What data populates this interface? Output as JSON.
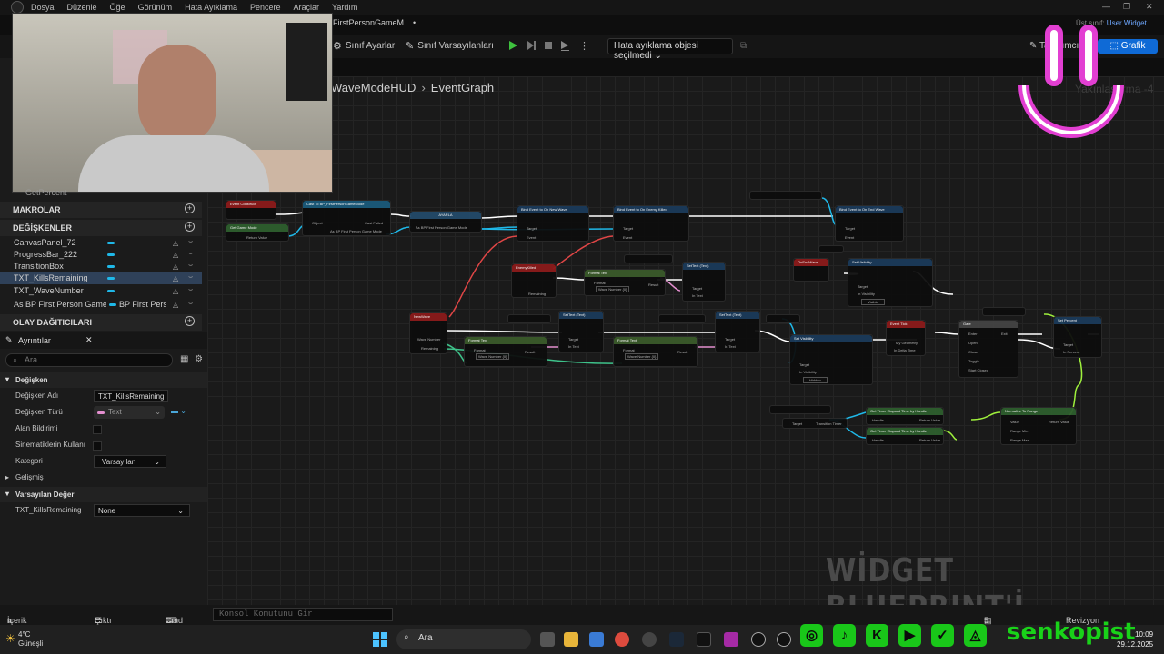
{
  "menu": [
    "Dosya",
    "Düzenle",
    "Öğe",
    "Görünüm",
    "Hata Ayıklama",
    "Pencere",
    "Araçlar",
    "Yardım"
  ],
  "document_tab": "FirstPersonGameM... •",
  "parent_class": {
    "label": "Üst sınıf:",
    "value": "User Widget"
  },
  "toolbar": {
    "class_settings": "Sınıf Ayarları",
    "class_defaults": "Sınıf Varsayılanları",
    "debug_select": "Hata ayıklama objesi seçilmedi",
    "graph_button": "Grafik",
    "designer_label": "Tasarımcı"
  },
  "breadcrumb": {
    "parent": "WaveModeHUD",
    "current": "EventGraph"
  },
  "zoom_label": "Yakınlaştırma -4",
  "watermark": "WİDGET BLUEPRINT'İ",
  "left_panel": {
    "partial_item": "GetPercent",
    "macros_label": "MAKROLAR",
    "variables_label": "DEĞİŞKENLER",
    "variables": [
      {
        "name": "CanvasPanel_72",
        "selected": false
      },
      {
        "name": "ProgressBar_222",
        "selected": false
      },
      {
        "name": "TransitionBox",
        "selected": false
      },
      {
        "name": "TXT_KillsRemaining",
        "selected": true
      },
      {
        "name": "TXT_WaveNumber",
        "selected": false
      },
      {
        "name": "As BP First Person Game M",
        "type": "BP First Perso",
        "selected": false
      }
    ],
    "dispatchers_label": "OLAY DAĞITICILARI"
  },
  "details": {
    "tab": "Ayrıntılar",
    "search_placeholder": "Ara",
    "variable_section": "Değişken",
    "props": [
      {
        "label": "Değişken Adı",
        "value": "TXT_KillsRemaining"
      },
      {
        "label": "Değişken Türü",
        "value": "Text"
      },
      {
        "label": "Alan Bildirimi",
        "value": ""
      },
      {
        "label": "Sinematiklerin Kullanı",
        "value": ""
      },
      {
        "label": "Kategori",
        "value": "Varsayılan"
      }
    ],
    "advanced": "Gelişmiş",
    "default_section": "Varsayılan Değer",
    "default_prop": {
      "label": "TXT_KillsRemaining",
      "value": "None"
    }
  },
  "status": {
    "content_drawer": "İçerik Çekmecesi",
    "output_log": "Çıktı Günlüğü",
    "cmd": "Cmd",
    "cmd_placeholder": "Konsol Komutunu Gir",
    "saved": "5 Kaydedilmedi",
    "revision": "Revizyon Kontrolü"
  },
  "taskbar": {
    "temp": "4°C",
    "weather": "Güneşli",
    "search": "Ara",
    "time": "10:09",
    "date": "29.12.2025"
  },
  "brand": "senkopist",
  "nodes": [
    {
      "id": "n1",
      "title": "Event Construct",
      "color": "#8b1a1a",
      "pins": [
        "",
        ""
      ]
    },
    {
      "id": "n2",
      "title": "Cast To BP_FirstPersonGameMode",
      "color": "#1a5a7a",
      "pins": [
        "Object",
        "Cast Failed",
        "As BP First Person Game Mode"
      ]
    },
    {
      "id": "n3",
      "title": "Get Game Mode",
      "color": "#2e5e2e",
      "pins": [
        "Return Value"
      ]
    },
    {
      "id": "n4",
      "title": "AYARLA",
      "color": "#234a6a",
      "pins": [
        "As BP First Person Game Mode"
      ]
    },
    {
      "id": "n5",
      "title": "Bind Event to On New Wave",
      "color": "#1a3a5a",
      "pins": [
        "Target",
        "Event"
      ]
    },
    {
      "id": "n6",
      "title": "Bind Event to On Enemy Killed",
      "color": "#1a3a5a",
      "pins": [
        "Target",
        "Event"
      ]
    },
    {
      "id": "n7",
      "title": "Bind Event to On End Wave",
      "color": "#1a3a5a",
      "pins": [
        "Target",
        "Event"
      ]
    },
    {
      "id": "n8",
      "title": "EnemyKilled",
      "color": "#8b1a1a",
      "pins": [
        "Remaining"
      ]
    },
    {
      "id": "n9",
      "title": "Format Text",
      "color": "#3a5a2a",
      "pins": [
        "Format",
        "Wave Number {0}",
        "Result"
      ]
    },
    {
      "id": "n10",
      "title": "SetText (Text)",
      "color": "#1a3a5a",
      "pins": [
        "Target",
        "In Text"
      ]
    },
    {
      "id": "n11",
      "title": "NewWave",
      "color": "#8b1a1a",
      "pins": [
        "Wave Number",
        "Remaining"
      ]
    },
    {
      "id": "n12",
      "title": "Format Text",
      "color": "#3a5a2a",
      "pins": [
        "Format",
        "Wave Number {0}",
        "Result"
      ]
    },
    {
      "id": "n13",
      "title": "SetText (Text)",
      "color": "#1a3a5a",
      "pins": [
        "Target",
        "In Text"
      ]
    },
    {
      "id": "n14",
      "title": "Format Text",
      "color": "#3a5a2a",
      "pins": [
        "Format",
        "Wave Number {0}",
        "Result"
      ]
    },
    {
      "id": "n15",
      "title": "SetText (Text)",
      "color": "#1a3a5a",
      "pins": [
        "Target",
        "In Text"
      ]
    },
    {
      "id": "n16",
      "title": "OnEndWave",
      "color": "#8b1a1a",
      "pins": []
    },
    {
      "id": "n17",
      "title": "Set Visibility",
      "color": "#1a3a5a",
      "pins": [
        "Target",
        "In Visibility",
        "Visible"
      ]
    },
    {
      "id": "n18",
      "title": "Set Visibility",
      "color": "#1a3a5a",
      "pins": [
        "Target",
        "In Visibility",
        "Hidden"
      ]
    },
    {
      "id": "n19",
      "title": "Event Tick",
      "color": "#8b1a1a",
      "pins": [
        "My Geometry",
        "In Delta Time"
      ]
    },
    {
      "id": "n20",
      "title": "Gate",
      "color": "#444",
      "pins": [
        "Enter",
        "Open",
        "Close",
        "Toggle",
        "Start Closed",
        "Exit"
      ]
    },
    {
      "id": "n21",
      "title": "Set Percent",
      "color": "#1a3a5a",
      "pins": [
        "Target",
        "In Percent"
      ]
    },
    {
      "id": "n22",
      "title": "Get Timer Elapsed Time by Handle",
      "color": "#2e5e2e",
      "pins": [
        "Handle",
        "Return Value"
      ]
    },
    {
      "id": "n23",
      "title": "Get Timer Elapsed Time by Handle",
      "color": "#2e5e2e",
      "pins": [
        "Handle",
        "Return Value"
      ]
    },
    {
      "id": "n24",
      "title": "Normalize To Range",
      "color": "#2e5e2e",
      "pins": [
        "Value",
        "Range Min",
        "Range Max",
        "Return Value"
      ]
    },
    {
      "id": "n25",
      "title": "Transition Timer",
      "color": "#1a3a5a",
      "pins": [
        "Target",
        "Transition Timer"
      ]
    }
  ]
}
